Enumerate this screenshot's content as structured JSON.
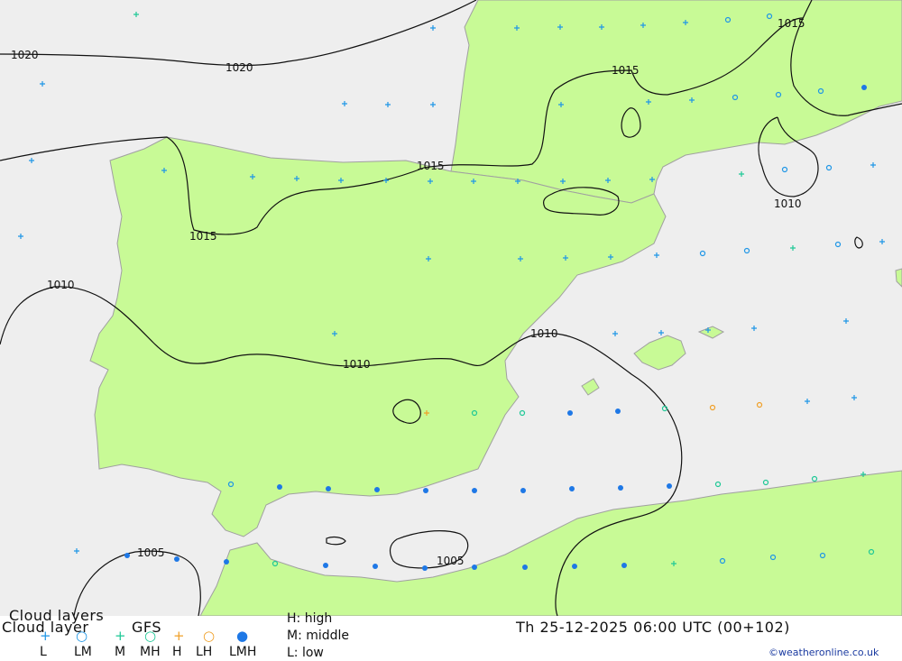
{
  "map": {
    "sea_color": "#eeeeee",
    "land_color": "#c8fa96",
    "coast_color": "#a0a0a0",
    "isobar_color": "#111111",
    "isobar_labels": [
      "1020",
      "1020",
      "1015",
      "1015",
      "1015",
      "1015",
      "1010",
      "1010",
      "1010",
      "1010",
      "1005",
      "1005"
    ]
  },
  "legend": {
    "title_line1": "Cloud layers",
    "title_line2": "Cloud layer",
    "model": "GFS",
    "codes": [
      "L",
      "LM",
      "M",
      "MH",
      "H",
      "LH",
      "LMH"
    ],
    "h_line": "H: high",
    "m_line": "M: middle",
    "l_line": "L: low",
    "datetime": "Th 25-12-2025 06:00 UTC (00+102)",
    "credit": "©weatheronline.co.uk",
    "colors": {
      "low": "#1e96e6",
      "middle": "#1ec896",
      "high": "#f0a028",
      "lmh": "#1e78e6"
    }
  }
}
